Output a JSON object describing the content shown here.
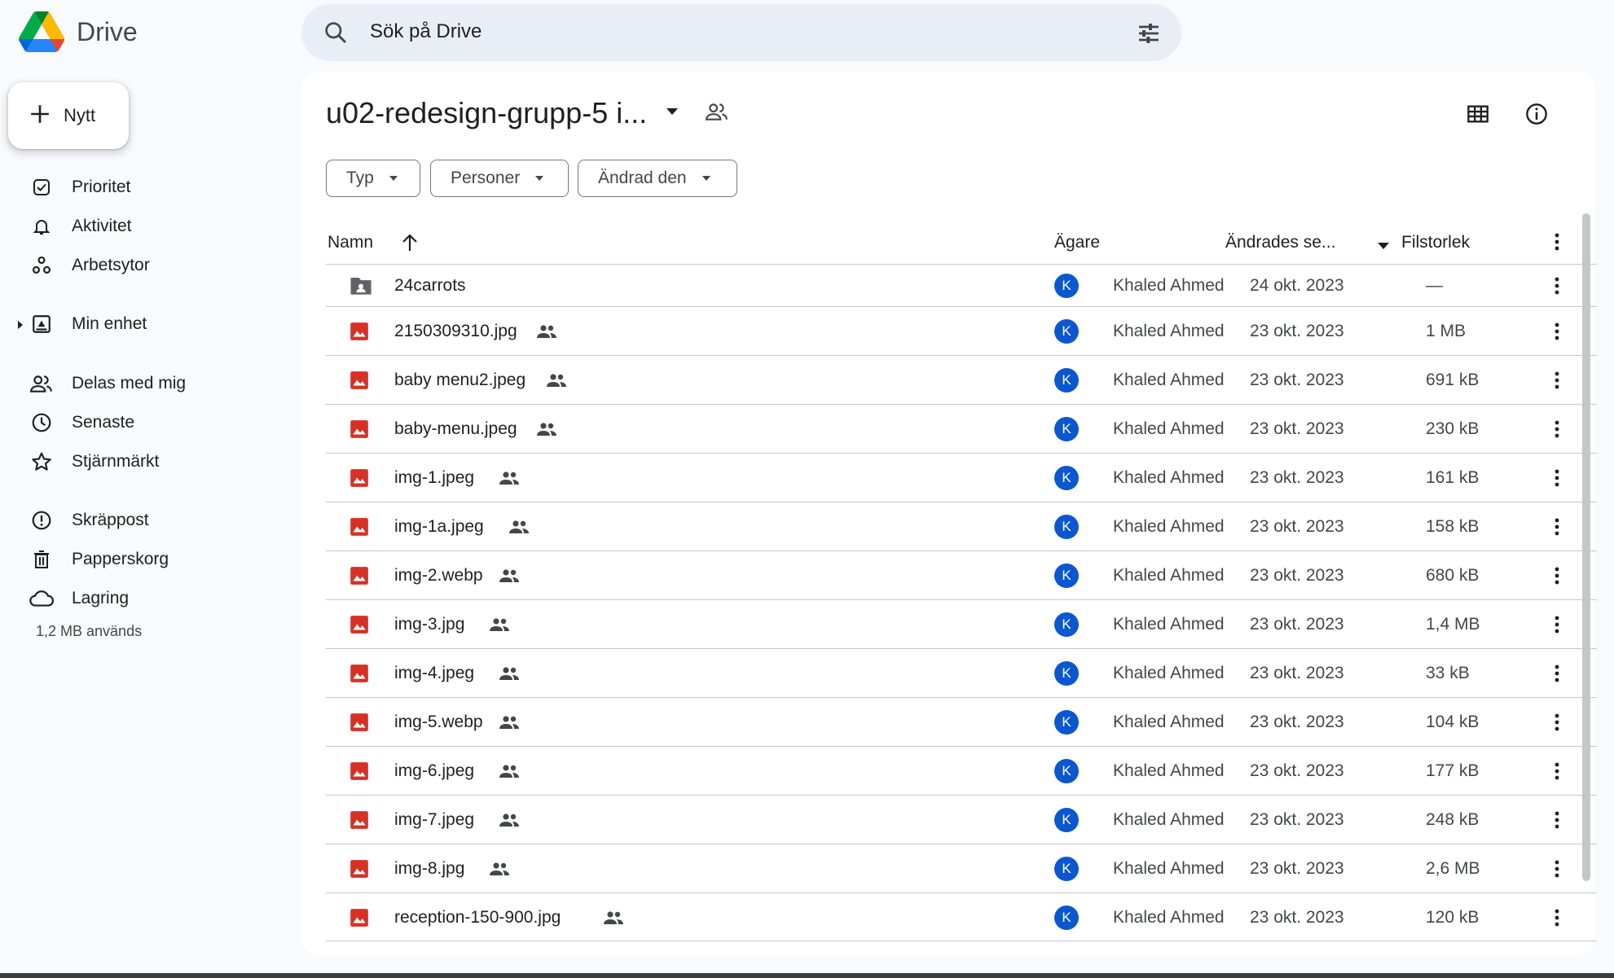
{
  "app": {
    "name": "Drive"
  },
  "search": {
    "placeholder": "Sök på Drive"
  },
  "new_button": {
    "label": "Nytt"
  },
  "nav": {
    "items": [
      {
        "label": "Prioritet",
        "icon": "priority-icon"
      },
      {
        "label": "Aktivitet",
        "icon": "bell-icon"
      },
      {
        "label": "Arbetsytor",
        "icon": "workspaces-icon"
      },
      {
        "label": "Min enhet",
        "icon": "my-drive-icon"
      },
      {
        "label": "Delas med mig",
        "icon": "shared-icon"
      },
      {
        "label": "Senaste",
        "icon": "clock-icon"
      },
      {
        "label": "Stjärnmärkt",
        "icon": "star-icon"
      },
      {
        "label": "Skräppost",
        "icon": "spam-icon"
      },
      {
        "label": "Papperskorg",
        "icon": "trash-icon"
      },
      {
        "label": "Lagring",
        "icon": "cloud-icon"
      }
    ],
    "storage_text": "1,2 MB används"
  },
  "folder": {
    "title": "u02-redesign-grupp-5 i..."
  },
  "filters": [
    {
      "label": "Typ"
    },
    {
      "label": "Personer"
    },
    {
      "label": "Ändrad den"
    }
  ],
  "table": {
    "columns": {
      "name": "Namn",
      "owner": "Ägare",
      "modified": "Ändrades se...",
      "size": "Filstorlek"
    },
    "rows": [
      {
        "name": "24carrots",
        "type": "folder",
        "shared": false,
        "owner": "Khaled Ahmed",
        "avatar": "K",
        "modified": "24 okt. 2023",
        "size": "—"
      },
      {
        "name": "2150309310.jpg",
        "type": "image",
        "shared": true,
        "owner": "Khaled Ahmed",
        "avatar": "K",
        "modified": "23 okt. 2023",
        "size": "1 MB"
      },
      {
        "name": "baby menu2.jpeg",
        "type": "image",
        "shared": true,
        "owner": "Khaled Ahmed",
        "avatar": "K",
        "modified": "23 okt. 2023",
        "size": "691 kB"
      },
      {
        "name": "baby-menu.jpeg",
        "type": "image",
        "shared": true,
        "owner": "Khaled Ahmed",
        "avatar": "K",
        "modified": "23 okt. 2023",
        "size": "230 kB"
      },
      {
        "name": "img-1.jpeg",
        "type": "image",
        "shared": true,
        "owner": "Khaled Ahmed",
        "avatar": "K",
        "modified": "23 okt. 2023",
        "size": "161 kB"
      },
      {
        "name": "img-1a.jpeg",
        "type": "image",
        "shared": true,
        "owner": "Khaled Ahmed",
        "avatar": "K",
        "modified": "23 okt. 2023",
        "size": "158 kB"
      },
      {
        "name": "img-2.webp",
        "type": "image",
        "shared": true,
        "owner": "Khaled Ahmed",
        "avatar": "K",
        "modified": "23 okt. 2023",
        "size": "680 kB"
      },
      {
        "name": "img-3.jpg",
        "type": "image",
        "shared": true,
        "owner": "Khaled Ahmed",
        "avatar": "K",
        "modified": "23 okt. 2023",
        "size": "1,4 MB"
      },
      {
        "name": "img-4.jpeg",
        "type": "image",
        "shared": true,
        "owner": "Khaled Ahmed",
        "avatar": "K",
        "modified": "23 okt. 2023",
        "size": "33 kB"
      },
      {
        "name": "img-5.webp",
        "type": "image",
        "shared": true,
        "owner": "Khaled Ahmed",
        "avatar": "K",
        "modified": "23 okt. 2023",
        "size": "104 kB"
      },
      {
        "name": "img-6.jpeg",
        "type": "image",
        "shared": true,
        "owner": "Khaled Ahmed",
        "avatar": "K",
        "modified": "23 okt. 2023",
        "size": "177 kB"
      },
      {
        "name": "img-7.jpeg",
        "type": "image",
        "shared": true,
        "owner": "Khaled Ahmed",
        "avatar": "K",
        "modified": "23 okt. 2023",
        "size": "248 kB"
      },
      {
        "name": "img-8.jpg",
        "type": "image",
        "shared": true,
        "owner": "Khaled Ahmed",
        "avatar": "K",
        "modified": "23 okt. 2023",
        "size": "2,6 MB"
      },
      {
        "name": "reception-150-900.jpg",
        "type": "image",
        "shared": true,
        "owner": "Khaled Ahmed",
        "avatar": "K",
        "modified": "23 okt. 2023",
        "size": "120 kB"
      }
    ]
  },
  "colors": {
    "accent": "#0b57d0",
    "image_icon": "#d93025",
    "folder_icon": "#5f6368"
  }
}
